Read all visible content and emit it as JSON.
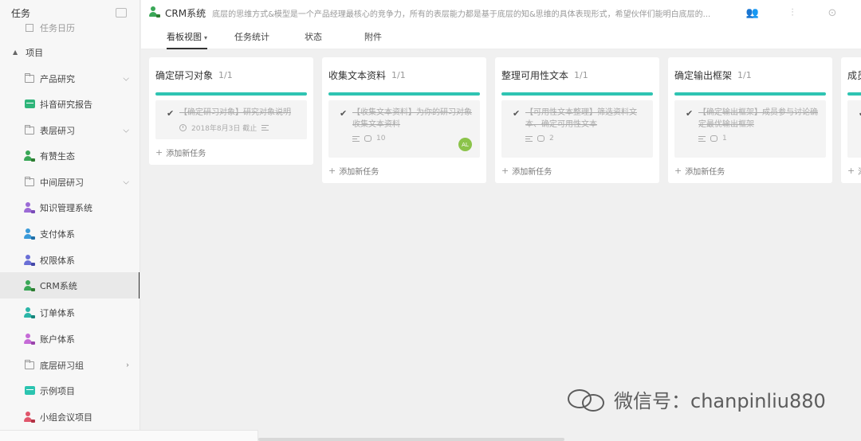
{
  "sidebar": {
    "title": "任务",
    "partial_item": "任务日历",
    "section": "项目",
    "items": [
      {
        "label": "产品研究",
        "type": "folder",
        "chevron": "v"
      },
      {
        "label": "抖音研究报告",
        "type": "box",
        "color": "#2fb57a"
      },
      {
        "label": "表层研习",
        "type": "folder",
        "chevron": "v"
      },
      {
        "label": "有赞生态",
        "type": "user",
        "color": "#3aa757"
      },
      {
        "label": "中间层研习",
        "type": "folder",
        "chevron": "v"
      },
      {
        "label": "知识管理系统",
        "type": "user",
        "color": "#9c6bd6"
      },
      {
        "label": "支付体系",
        "type": "user",
        "color": "#3a9ad9"
      },
      {
        "label": "权限体系",
        "type": "user",
        "color": "#6a6fd6"
      },
      {
        "label": "CRM系统",
        "type": "user",
        "color": "#3aa757",
        "active": true
      },
      {
        "label": "订单体系",
        "type": "user",
        "color": "#2bb5a8"
      },
      {
        "label": "账户体系",
        "type": "user",
        "color": "#c56bd6"
      },
      {
        "label": "底层研习组",
        "type": "folder",
        "chevron": ">"
      },
      {
        "label": "示例项目",
        "type": "box",
        "color": "#2bc4b0"
      },
      {
        "label": "小组会议项目",
        "type": "user",
        "color": "#e0566b"
      }
    ]
  },
  "header": {
    "title": "CRM系统",
    "description": "底层的思维方式&模型是一个产品经理最核心的竞争力，所有的表层能力都是基于底层的知&思维的具体表现形式，希望伙伴们能明白底层的..."
  },
  "tabs": [
    {
      "label": "看板视图",
      "active": true
    },
    {
      "label": "任务统计"
    },
    {
      "label": "状态"
    },
    {
      "label": "附件"
    }
  ],
  "columns": [
    {
      "title": "确定研习对象",
      "count": "1/1",
      "card": {
        "text": "【确定研习对象】研究对象说明",
        "date": "2018年8月3日 截止",
        "comments": ""
      },
      "add_label": "添加新任务"
    },
    {
      "title": "收集文本资料",
      "count": "1/1",
      "card": {
        "text": "【收集文本资料】为你的研习对象收集文本资料",
        "comments": "10",
        "avatar": "AL"
      },
      "add_label": "添加新任务"
    },
    {
      "title": "整理可用性文本",
      "count": "1/1",
      "card": {
        "text": "【可用性文本整理】筛选资料文本、确定可用性文本",
        "comments": "2"
      },
      "add_label": "添加新任务"
    },
    {
      "title": "确定输出框架",
      "count": "1/1",
      "card": {
        "text": "【确定输出框架】成员参与讨论确定最优输出框架",
        "comments": "1"
      },
      "add_label": "添加新任务"
    },
    {
      "title": "成员",
      "count": "",
      "card": {
        "text": "",
        "comments": ""
      },
      "add_label": "添"
    }
  ],
  "watermark": "微信号：chanpinliu880"
}
